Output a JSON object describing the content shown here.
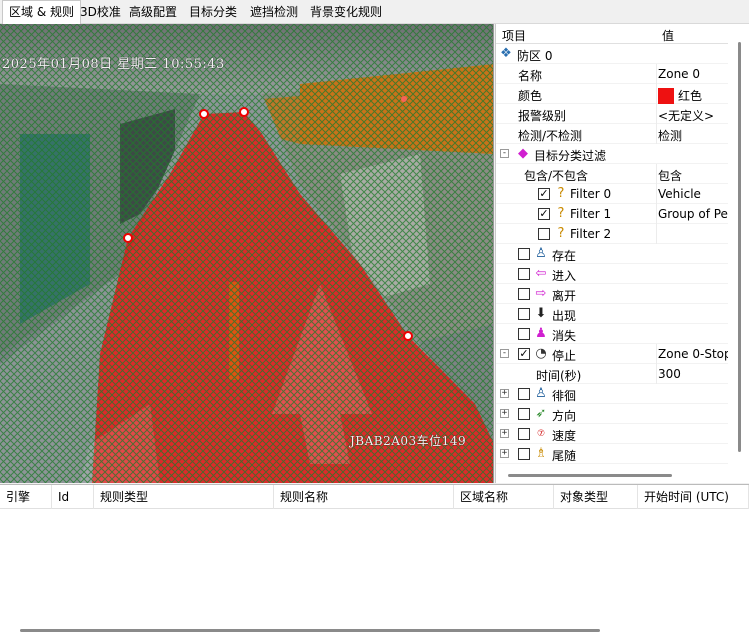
{
  "tabs": [
    {
      "label": "区域 & 规则",
      "active": true
    },
    {
      "label": "3D校准",
      "active": false
    },
    {
      "label": "高级配置",
      "active": false
    },
    {
      "label": "目标分类",
      "active": false
    },
    {
      "label": "遮挡检测",
      "active": false
    },
    {
      "label": "背景变化规则",
      "active": false
    }
  ],
  "video": {
    "timestamp": "2025年01月08日 星期三 10:55:43",
    "plate_label": "JBAB2A03车位149",
    "zone_color": "#ee1111"
  },
  "properties": {
    "header": {
      "item": "项目",
      "value": "值"
    },
    "rows": [
      {
        "name": "防区 0",
        "icon": "zone-icon",
        "level": 0,
        "expander": null,
        "checkbox": null
      },
      {
        "name": "名称",
        "value": "Zone 0",
        "level": 1
      },
      {
        "name": "颜色",
        "value": "红色",
        "level": 1,
        "swatch": "#ee1111"
      },
      {
        "name": "报警级别",
        "value": "<无定义>",
        "level": 1
      },
      {
        "name": "检测/不检测",
        "value": "检测",
        "level": 1
      },
      {
        "name": "目标分类过滤",
        "icon": "filter-icon",
        "level": 1,
        "expander": "-"
      },
      {
        "name": "包含/不包含",
        "value": "包含",
        "level": 2
      },
      {
        "name": "Filter 0",
        "value": "Vehicle",
        "level": 2,
        "checkbox": true,
        "icon": "question-icon"
      },
      {
        "name": "Filter 1",
        "value": "Group of Pe",
        "level": 2,
        "checkbox": true,
        "icon": "question-icon"
      },
      {
        "name": "Filter 2",
        "value": "",
        "level": 2,
        "checkbox": false,
        "icon": "question-icon"
      },
      {
        "name": "存在",
        "level": 1,
        "checkbox": false,
        "icon": "person-icon"
      },
      {
        "name": "进入",
        "level": 1,
        "checkbox": false,
        "icon": "enter-arrow-icon"
      },
      {
        "name": "离开",
        "level": 1,
        "checkbox": false,
        "icon": "exit-arrow-icon"
      },
      {
        "name": "出现",
        "level": 1,
        "checkbox": false,
        "icon": "appear-icon"
      },
      {
        "name": "消失",
        "level": 1,
        "checkbox": false,
        "icon": "disappear-icon"
      },
      {
        "name": "停止",
        "value": "Zone 0-Stop",
        "level": 1,
        "checkbox": true,
        "icon": "clock-icon",
        "expander": "-"
      },
      {
        "name": "时间(秒)",
        "value": "300",
        "level": 2
      },
      {
        "name": "徘徊",
        "level": 1,
        "checkbox": false,
        "icon": "loiter-icon",
        "expander": "+"
      },
      {
        "name": "方向",
        "level": 1,
        "checkbox": false,
        "icon": "direction-icon",
        "expander": "+"
      },
      {
        "name": "速度",
        "level": 1,
        "checkbox": false,
        "icon": "speed-icon",
        "expander": "+"
      },
      {
        "name": "尾随",
        "level": 1,
        "checkbox": false,
        "icon": "tailgate-icon",
        "expander": "+"
      }
    ]
  },
  "events_table": {
    "columns": [
      "引擎",
      "Id",
      "规则类型",
      "规则名称",
      "区域名称",
      "对象类型",
      "开始时间 (UTC)"
    ],
    "rows": []
  }
}
